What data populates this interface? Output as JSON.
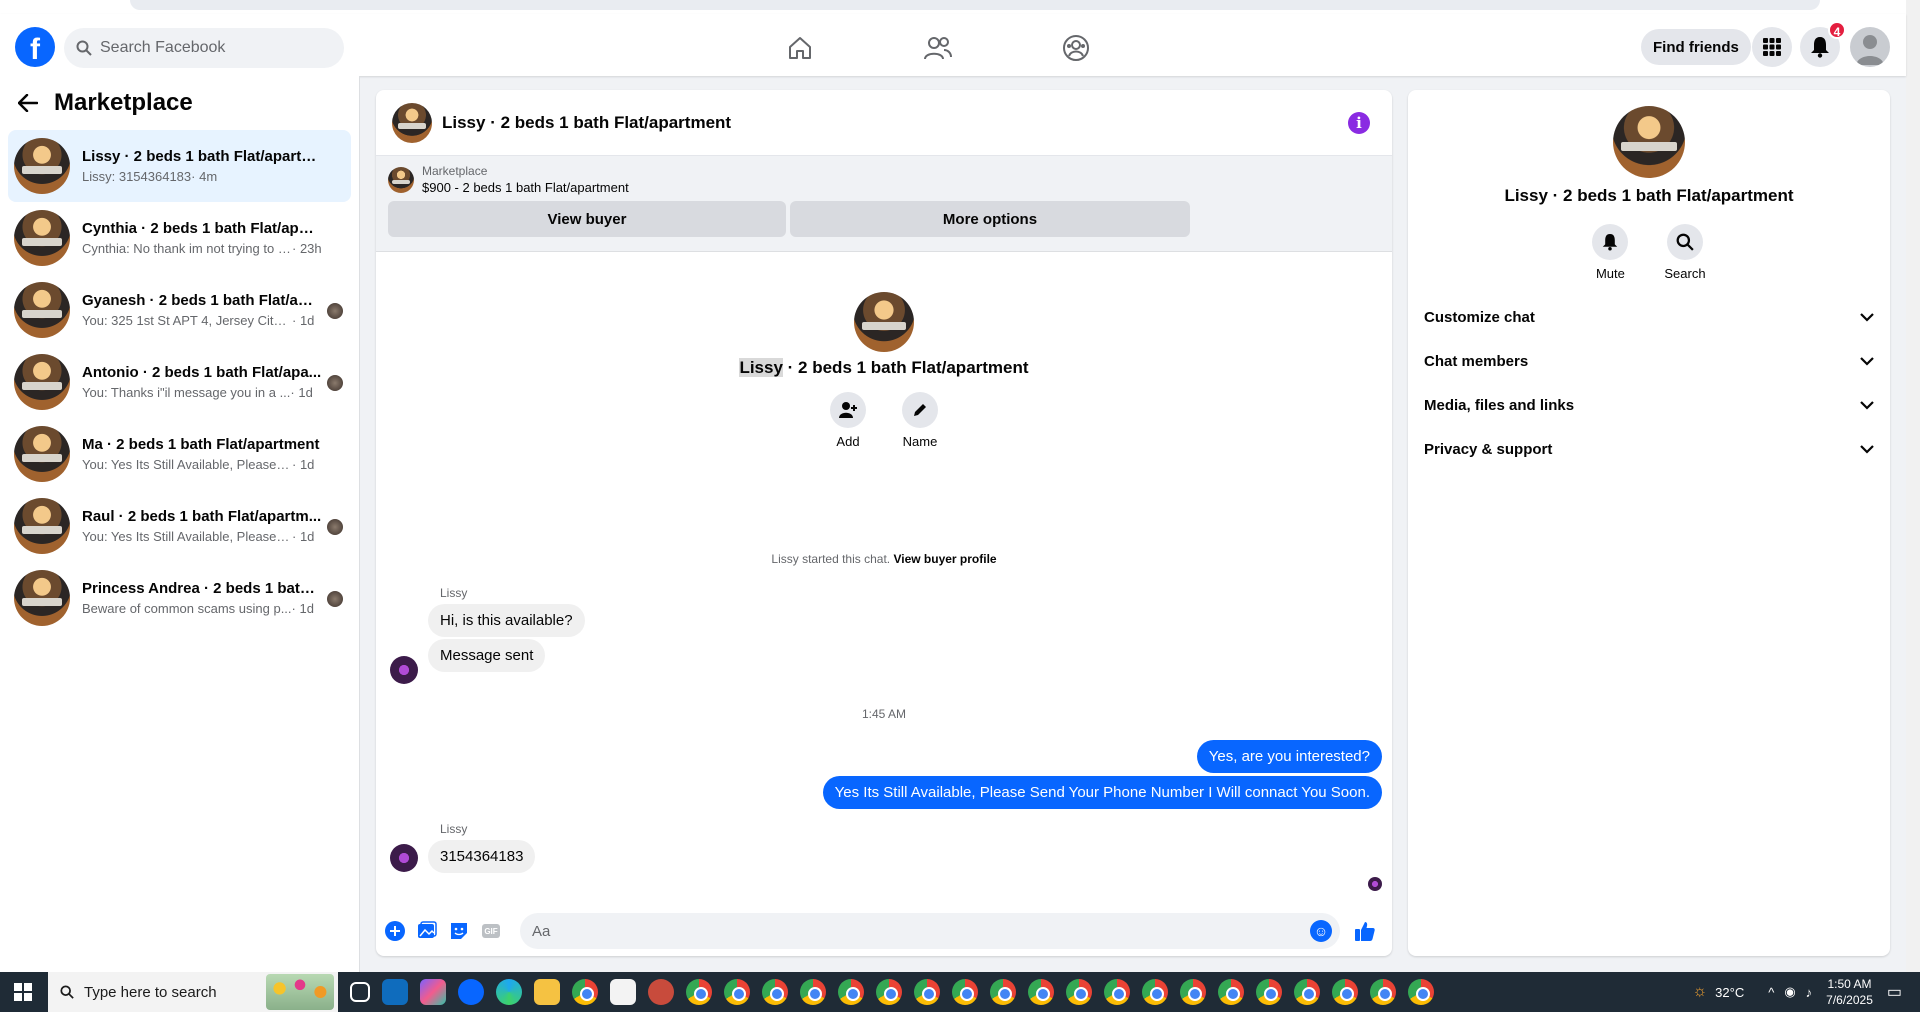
{
  "topnav": {
    "logo_letter": "f",
    "search_placeholder": "Search Facebook",
    "find_friends_label": "Find friends",
    "notification_count": "4"
  },
  "sidebar": {
    "title": "Marketplace",
    "conversations": [
      {
        "title": "Lissy · 2 beds 1 bath Flat/apartment",
        "snippet": "Lissy: 3154364183",
        "time": " · 4m",
        "active": true
      },
      {
        "title": "Cynthia · 2 beds 1 bath Flat/apart...",
        "snippet": "Cynthia: No thank im not trying to m...",
        "time": " · 23h"
      },
      {
        "title": "Gyanesh · 2 beds 1 bath Flat/apa...",
        "snippet": "You: 325 1st St APT 4, Jersey City, ...",
        "time": " · 1d"
      },
      {
        "title": "Antonio · 2 beds 1 bath Flat/apa...",
        "snippet": "You: Thanks i\"il message you in a ...",
        "time": " · 1d"
      },
      {
        "title": "Ma · 2 beds 1 bath Flat/apartment",
        "snippet": "You: Yes Its Still Available, Please Send...",
        "time": " · 1d"
      },
      {
        "title": "Raul · 2 beds 1 bath Flat/apartm...",
        "snippet": "You: Yes Its Still Available, Please Se...",
        "time": " · 1d"
      },
      {
        "title": "Princess Andrea · 2 beds 1 bath ...",
        "snippet": "Beware of common scams using p...",
        "time": " · 1d"
      }
    ]
  },
  "chat": {
    "header_title": "Lissy · 2 beds 1 bath Flat/apartment",
    "info_glyph": "i",
    "marketplace_label": "Marketplace",
    "listing": "$900 - 2 beds 1 bath Flat/apartment",
    "view_buyer_label": "View buyer",
    "more_options_label": "More options",
    "intro_name": "Lissy",
    "intro_rest": " · 2 beds 1 bath Flat/apartment",
    "add_label": "Add",
    "name_label": "Name",
    "started_text": "Lissy started this chat. ",
    "view_buyer_profile": "View buyer profile",
    "messages": {
      "sender1": "Lissy",
      "m1": "Hi, is this available?",
      "m2": "Message sent",
      "timestamp": "1:45 AM",
      "m3": "Yes, are you interested?",
      "m4": "Yes Its Still Available, Please Send Your Phone Number I Will connact You Soon.",
      "sender2": "Lissy",
      "m5": "3154364183"
    },
    "composer_placeholder": "Aa",
    "gif_label": "GIF"
  },
  "info_panel": {
    "title": "Lissy · 2 beds 1 bath Flat/apartment",
    "mute_label": "Mute",
    "search_label": "Search",
    "sections": [
      "Customize chat",
      "Chat members",
      "Media, files and links",
      "Privacy & support"
    ]
  },
  "taskbar": {
    "search_placeholder": "Type here to search",
    "temperature": "32°C",
    "time": "1:50 AM",
    "date": "7/6/2025"
  },
  "colors": {
    "brand_blue": "#0866ff",
    "active_row": "#e7f3ff",
    "info_purple": "#8a2be2",
    "badge_red": "#e41e3f"
  }
}
